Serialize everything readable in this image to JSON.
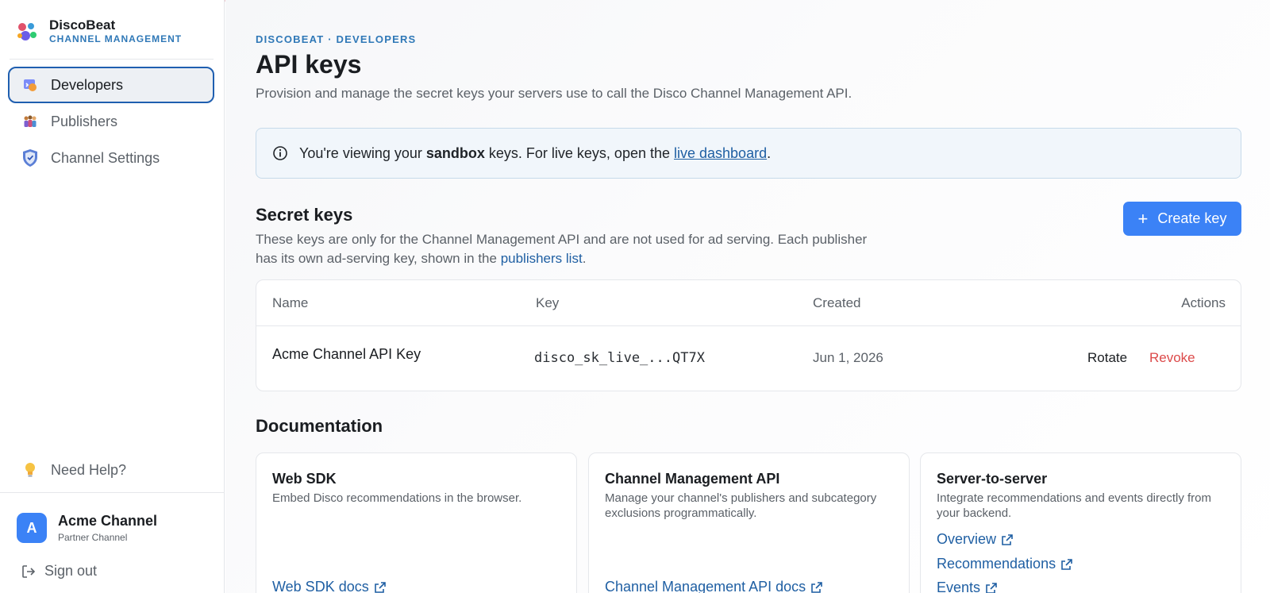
{
  "sidebar": {
    "brand_name": "DiscoBeat",
    "brand_sub": "CHANNEL MANAGEMENT",
    "items": [
      {
        "label": "Developers",
        "icon": "developer-icon",
        "active": true
      },
      {
        "label": "Publishers",
        "icon": "people-icon",
        "active": false
      },
      {
        "label": "Channel Settings",
        "icon": "shield-icon",
        "active": false
      }
    ],
    "help_label": "Need Help?",
    "user": {
      "initial": "A",
      "name": "Acme Channel",
      "role": "Partner Channel"
    },
    "signout_label": "Sign out"
  },
  "header": {
    "eyebrow": "DISCOBEAT · DEVELOPERS",
    "title": "API keys",
    "description": "Provision and manage the secret keys your servers use to call the Disco Channel Management API."
  },
  "notice": {
    "prefix": "You're viewing your ",
    "bold": "sandbox",
    "middle": " keys. For live keys, open the ",
    "link": "live dashboard",
    "suffix": "."
  },
  "secret_keys": {
    "title": "Secret keys",
    "description_prefix": "These keys are only for the Channel Management API and are not used for ad serving. Each publisher has its own ad-serving key, shown in the ",
    "description_link": "publishers list",
    "description_suffix": ".",
    "create_button": "Create key",
    "columns": {
      "name": "Name",
      "key": "Key",
      "created": "Created",
      "actions": "Actions"
    },
    "rows": [
      {
        "name": "Acme Channel API Key",
        "key": "disco_sk_live_...QT7X",
        "created": "Jun 1, 2026",
        "rotate": "Rotate",
        "revoke": "Revoke"
      }
    ]
  },
  "documentation": {
    "title": "Documentation",
    "cards": [
      {
        "title": "Web SDK",
        "description": "Embed Disco recommendations in the browser.",
        "links": [
          "Web SDK docs"
        ]
      },
      {
        "title": "Channel Management API",
        "description": "Manage your channel's publishers and subcategory exclusions programmatically.",
        "links": [
          "Channel Management API docs"
        ]
      },
      {
        "title": "Server-to-server",
        "description": "Integrate recommendations and events directly from your backend.",
        "links": [
          "Overview",
          "Recommendations",
          "Events"
        ]
      }
    ]
  },
  "colors": {
    "accent": "#3b82f6",
    "link": "#1f5fa3",
    "danger": "#dc4a4a",
    "eyebrow": "#2f78b7"
  }
}
